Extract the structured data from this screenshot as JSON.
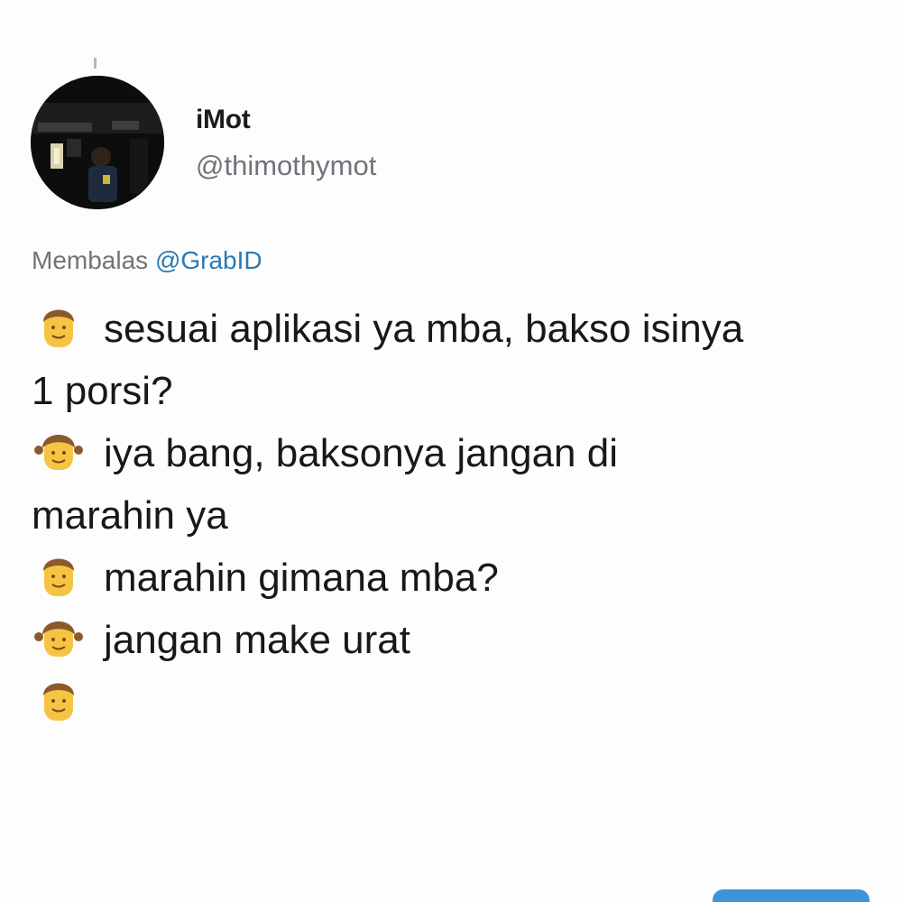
{
  "user": {
    "display_name": "iMot",
    "handle": "@thimothymot",
    "avatar_icon": "profile-photo"
  },
  "reply": {
    "prefix": "Membalas",
    "mention": "@GrabID",
    "mention_color": "#2a7ab5"
  },
  "messages": [
    {
      "speaker": "boy-emoji",
      "text": "sesuai aplikasi ya mba, bakso isinya"
    },
    {
      "speaker": "",
      "text": "1 porsi?"
    },
    {
      "speaker": "girl-emoji",
      "text": "iya bang, baksonya jangan di"
    },
    {
      "speaker": "",
      "text": "marahin ya"
    },
    {
      "speaker": "boy-emoji",
      "text": "marahin gimana mba?"
    },
    {
      "speaker": "girl-emoji",
      "text": "jangan make urat"
    },
    {
      "speaker": "boy-emoji",
      "text": ""
    }
  ],
  "colors": {
    "accent": "#3f93d9",
    "emoji_face": "#f6c443",
    "emoji_hair": "#8a5a2b"
  }
}
